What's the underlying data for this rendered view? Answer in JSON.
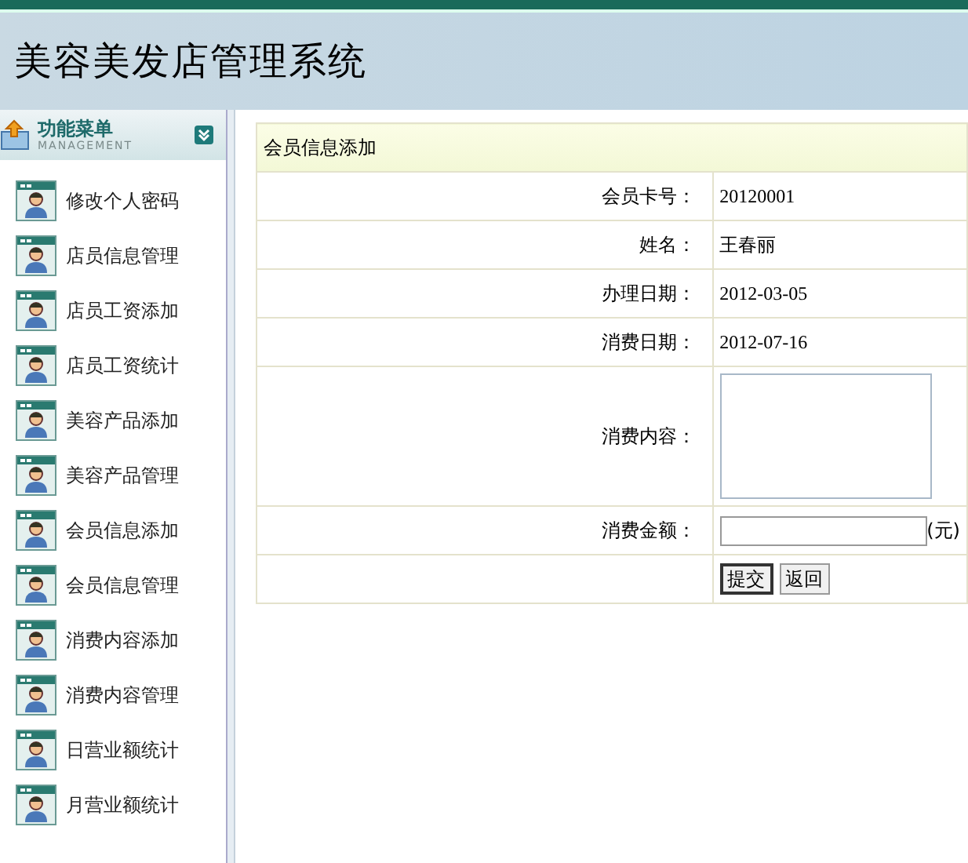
{
  "header": {
    "title": "美容美发店管理系统"
  },
  "sidebar": {
    "title": "功能菜单",
    "subtitle": "MANAGEMENT",
    "items": [
      {
        "label": "修改个人密码"
      },
      {
        "label": "店员信息管理"
      },
      {
        "label": "店员工资添加"
      },
      {
        "label": "店员工资统计"
      },
      {
        "label": "美容产品添加"
      },
      {
        "label": "美容产品管理"
      },
      {
        "label": "会员信息添加"
      },
      {
        "label": "会员信息管理"
      },
      {
        "label": "消费内容添加"
      },
      {
        "label": "消费内容管理"
      },
      {
        "label": "日营业额统计"
      },
      {
        "label": "月营业额统计"
      }
    ]
  },
  "form": {
    "title": "会员信息添加",
    "rows": [
      {
        "kind": "text",
        "label": "会员卡号：",
        "value": "20120001"
      },
      {
        "kind": "text",
        "label": "姓名：",
        "value": "王春丽"
      },
      {
        "kind": "text",
        "label": "办理日期：",
        "value": "2012-03-05"
      },
      {
        "kind": "text",
        "label": "消费日期：",
        "value": "2012-07-16"
      },
      {
        "kind": "textarea",
        "label": "消费内容："
      },
      {
        "kind": "input",
        "label": "消费金额：",
        "unit": "(元)"
      },
      {
        "kind": "buttons",
        "buttons": [
          "提交",
          "返回"
        ]
      }
    ]
  }
}
